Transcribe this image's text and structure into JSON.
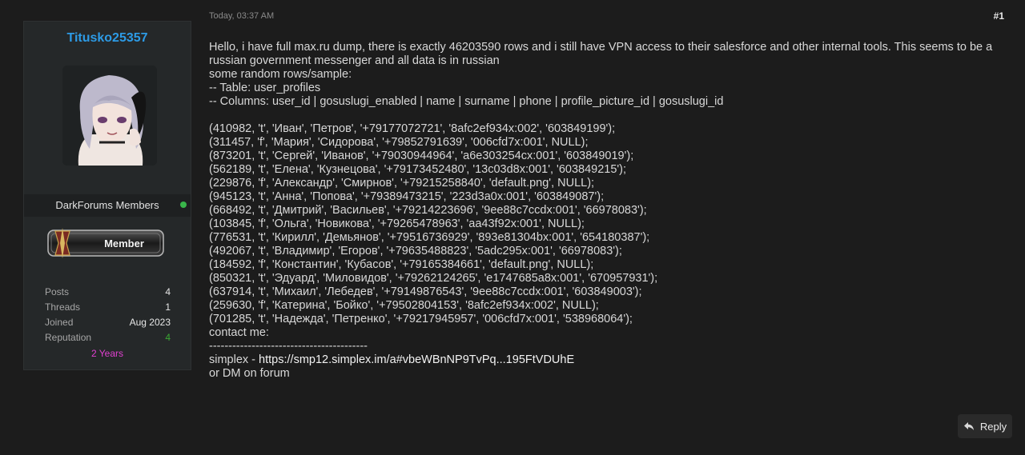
{
  "user": {
    "username": "Titusko25357",
    "group": "DarkForums Members",
    "badge_label": "Member",
    "stats": [
      {
        "label": "Posts",
        "value": "4"
      },
      {
        "label": "Threads",
        "value": "1"
      },
      {
        "label": "Joined",
        "value": "Aug 2023"
      },
      {
        "label": "Reputation",
        "value": "4"
      }
    ],
    "tenure": "2 Years"
  },
  "post": {
    "date": "Today, 03:37 AM",
    "number": "#1",
    "intro": "Hello, i have full max.ru dump, there is exactly 46203590 rows and i still have VPN access to their salesforce and other internal tools. This seems to be a russian government messenger and all data is in russian",
    "lines_before": [
      "some random rows/sample:",
      "-- Table: user_profiles",
      "-- Columns: user_id | gosuslugi_enabled | name | surname | phone | profile_picture_id | gosuslugi_id",
      "",
      "(410982, 't', 'Иван', 'Петров', '+79177072721', '8afc2ef934x:002', '603849199');",
      "(311457, 'f', 'Мария', 'Сидорова', '+79852791639', '006cfd7x:001', NULL);",
      "(873201, 't', 'Сергей', 'Иванов', '+79030944964', 'a6e303254cx:001', '603849019');",
      "(562189, 't', 'Елена', 'Кузнецова', '+79173452480', '13c03d8x:001', '603849215');",
      "(229876, 'f', 'Александр', 'Смирнов', '+79215258840', 'default.png', NULL);",
      "(945123, 't', 'Анна', 'Попова', '+79389473215', '223d3a0x:001', '603849087');",
      "(668492, 't', 'Дмитрий', 'Васильев', '+79214223696', '9ee88c7ccdx:001', '66978083');",
      "(103845, 'f', 'Ольга', 'Новикова', '+79265478963', 'aa43f92x:001', NULL);",
      "(776531, 't', 'Кирилл', 'Демьянов', '+79516736929', '893e81304bx:001', '654180387');",
      "(492067, 't', 'Владимир', 'Егоров', '+79635488823', '5adc295x:001', '66978083');",
      "(184592, 'f', 'Константин', 'Кубасов', '+79165384661', 'default.png', NULL);",
      "(850321, 't', 'Эдуард', 'Миловидов', '+79262124265', 'e1747685a8x:001', '670957931');",
      "(637914, 't', 'Михаил', 'Лебедев', '+79149876543', '9ee88c7ccdx:001', '603849003');",
      "(259630, 'f', 'Катерина', 'Бойко', '+79502804153', '8afc2ef934x:002', NULL);",
      "(701285, 't', 'Надежда', 'Петренко', '+79217945957', '006cfd7x:001', '538968064');",
      "contact me:",
      "-----------------------------------------"
    ],
    "contact_prefix": "simplex - ",
    "contact_link": "https://smp12.simplex.im/a#vbeWBnNP9TvPq...195FtVDUhE",
    "closing": "or DM on forum"
  },
  "actions": {
    "reply_label": "Reply"
  }
}
